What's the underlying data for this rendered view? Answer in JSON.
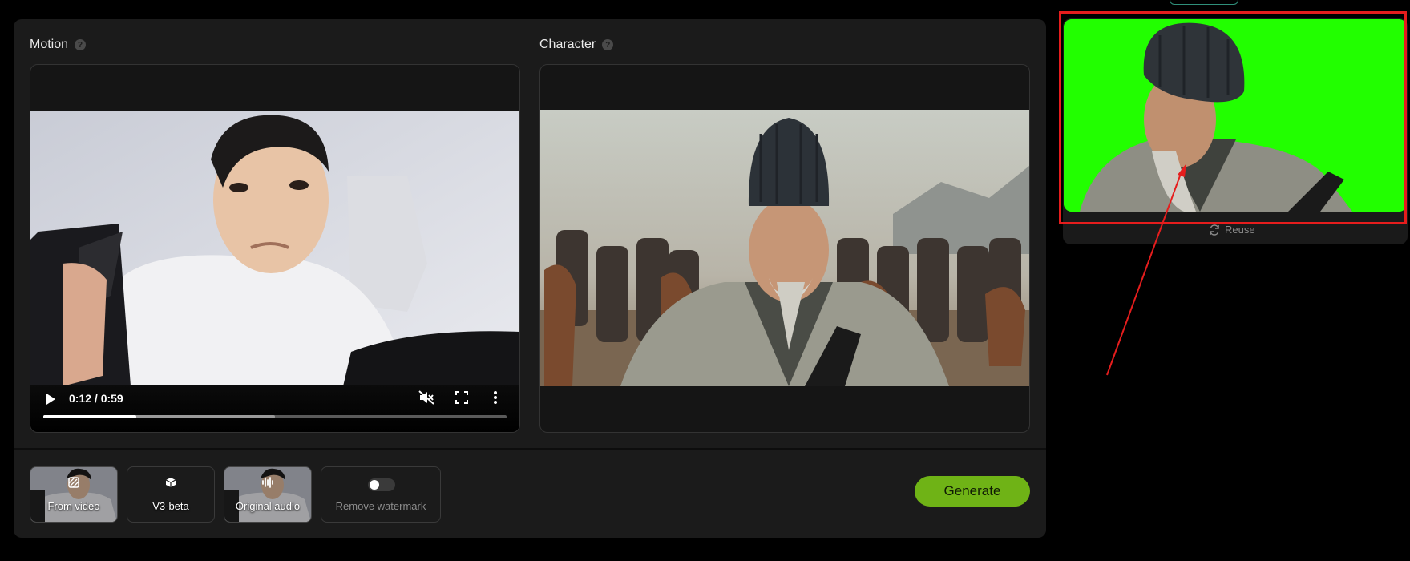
{
  "motion": {
    "label": "Motion",
    "help_icon": "help-icon",
    "player": {
      "time": "0:12 / 0:59",
      "progress": 0.2,
      "buffered": 0.5,
      "play_icon": "play-icon",
      "mute_icon": "volume-mute-icon",
      "fullscreen_icon": "fullscreen-icon",
      "more_icon": "more-vertical-icon"
    }
  },
  "character": {
    "label": "Character",
    "help_icon": "help-icon"
  },
  "options": [
    {
      "label": "From video",
      "icon": "no-background-icon"
    },
    {
      "label": "V3-beta",
      "icon": "cube-icon"
    },
    {
      "label": "Original audio",
      "icon": "audio-wave-icon"
    },
    {
      "label": "Remove watermark",
      "icon": "toggle-off"
    }
  ],
  "generate_label": "Generate",
  "result": {
    "reuse_label": "Reuse",
    "reuse_icon": "refresh-icon"
  },
  "colors": {
    "accent": "#6fb316",
    "highlight": "#e51d1d",
    "green_screen": "#22ff00",
    "panel": "#1b1b1b"
  }
}
